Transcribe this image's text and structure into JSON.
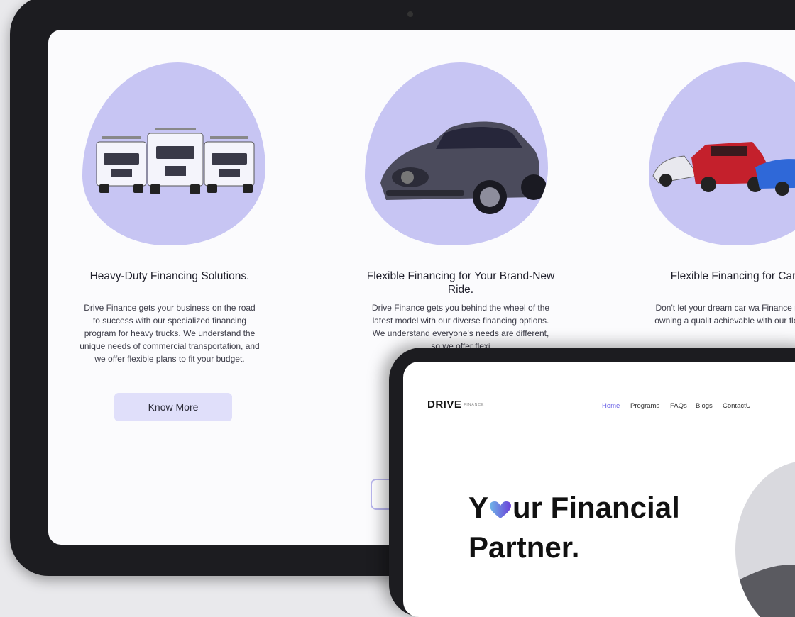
{
  "cards": [
    {
      "title": "Heavy-Duty Financing Solutions.",
      "body": "Drive Finance gets your business on the road to success with our specialized financing program for heavy trucks. We understand the unique needs of commercial transportation, and we offer flexible plans to fit your budget.",
      "button": "Know More",
      "image_subject": "heavy-trucks"
    },
    {
      "title": "Flexible Financing for Your Brand-New Ride.",
      "body": "Drive Finance gets you behind the wheel of the latest model with our diverse financing options. We understand everyone's needs are different, so we offer flexi",
      "image_subject": "new-car"
    },
    {
      "title": "Flexible Financing for Cars.",
      "body": "Don't let your dream car wa Finance makes owning a qualit achievable with our flexible f",
      "image_subject": "used-cars"
    }
  ],
  "outline_button_partial": "S",
  "front": {
    "logo": "DRIVE",
    "logo_sub": "FINANCE",
    "nav": [
      "Home",
      "Programs",
      "FAQs",
      "Blogs",
      "ContactU"
    ],
    "nav_active": "Home",
    "hero_line1_pre": "Y",
    "hero_line1_post": "ur Financial",
    "hero_line2": "Partner."
  },
  "colors": {
    "accent": "#6a62e6",
    "blob": "#c7c5f3",
    "button_bg": "#e0dffa"
  }
}
